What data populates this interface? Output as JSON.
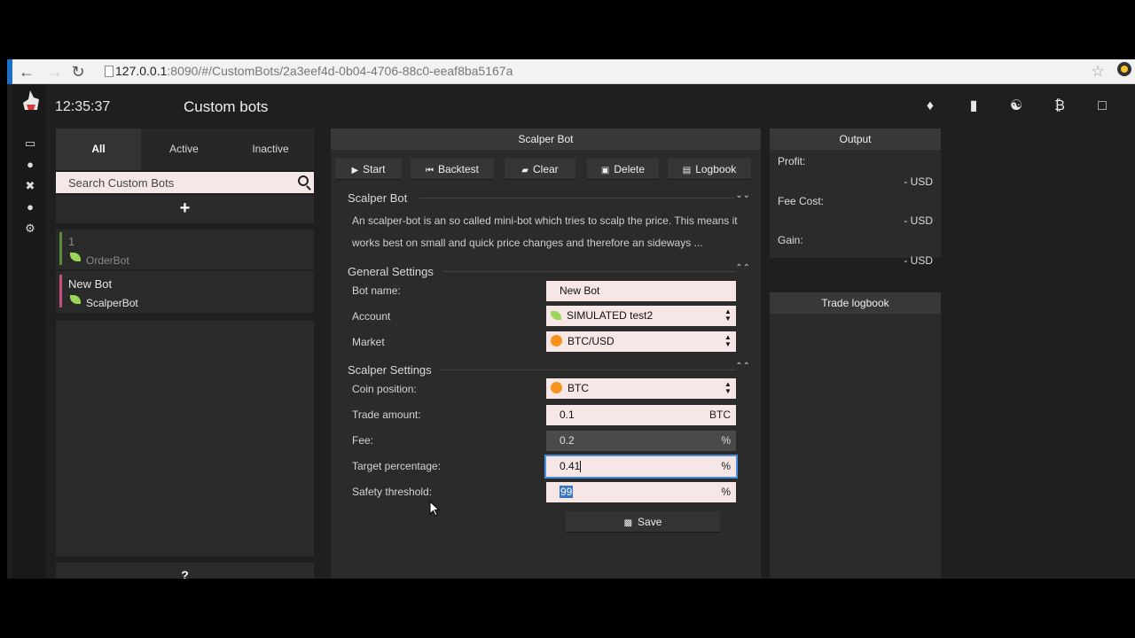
{
  "browser": {
    "url_host": "127.0.0.1",
    "url_rest": ":8090/#/CustomBots/2a3eef4d-0b04-4706-88c0-eeaf8ba5167a"
  },
  "header": {
    "time": "12:35:37",
    "title": "Custom bots"
  },
  "filters": {
    "all": "All",
    "active": "Active",
    "inactive": "Inactive"
  },
  "search": {
    "placeholder": "Search Custom Bots"
  },
  "add_label": "+",
  "bots": [
    {
      "name": "1",
      "type": "OrderBot",
      "stripe": "#5a8d3a"
    },
    {
      "name": "New Bot",
      "type": "ScalperBot",
      "stripe": "#c44f7a"
    }
  ],
  "help_label": "?",
  "bot_panel": {
    "header": "Scalper Bot",
    "actions": [
      "Start",
      "Backtest",
      "Clear",
      "Delete",
      "Logbook"
    ],
    "intro_title": "Scalper Bot",
    "description": "An scalper-bot is an so called mini-bot which tries to scalp the price. This means it works best on small and quick price changes and therefore an sideways ...",
    "general_title": "General Settings",
    "labels": {
      "bot_name": "Bot name:",
      "account": "Account",
      "market": "Market",
      "coin_position": "Coin position:",
      "trade_amount": "Trade amount:",
      "fee": "Fee:",
      "target_percentage": "Target percentage:",
      "safety_threshold": "Safety threshold:"
    },
    "values": {
      "bot_name": "New Bot",
      "account": "SIMULATED test2",
      "market": "BTC/USD",
      "coin_position": "BTC",
      "trade_amount": "0.1",
      "trade_amount_unit": "BTC",
      "fee": "0.2",
      "target_percentage": "0.41",
      "safety_threshold": "99",
      "percent": "%"
    },
    "scalper_title": "Scalper Settings",
    "save": "Save"
  },
  "output": {
    "header": "Output",
    "profit_label": "Profit:",
    "profit_value": "- USD",
    "fee_label": "Fee Cost:",
    "fee_value": "- USD",
    "gain_label": "Gain:",
    "gain_value": "- USD"
  },
  "logbook": {
    "header": "Trade logbook"
  },
  "colors": {
    "accent": "#1c6fc4",
    "field_bg": "#f6e6e6",
    "btc": "#f7931a"
  }
}
